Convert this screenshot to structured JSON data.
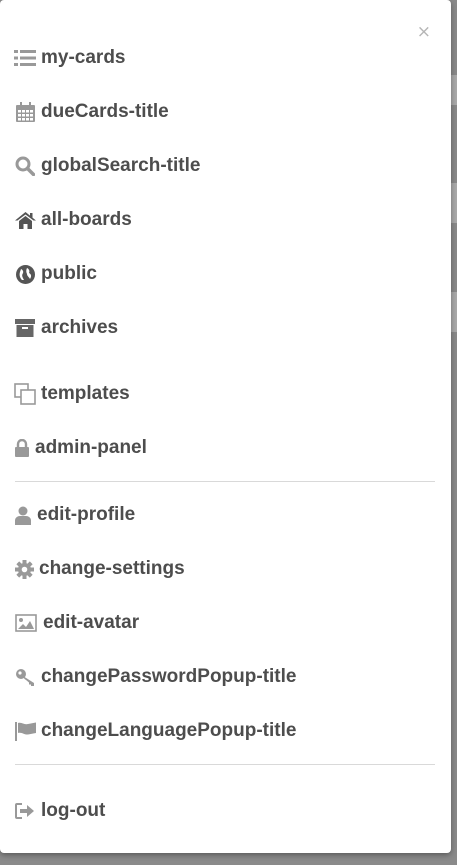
{
  "menu": {
    "close_symbol": "×",
    "items": [
      {
        "label": "my-cards",
        "icon": "list-icon"
      },
      {
        "label": "dueCards-title",
        "icon": "calendar-icon"
      },
      {
        "label": "globalSearch-title",
        "icon": "search-icon"
      },
      {
        "label": "all-boards",
        "icon": "home-icon"
      },
      {
        "label": "public",
        "icon": "globe-icon"
      },
      {
        "label": "archives",
        "icon": "archive-icon"
      },
      {
        "label": "templates",
        "icon": "copy-icon"
      },
      {
        "label": "admin-panel",
        "icon": "lock-icon"
      },
      {
        "label": "edit-profile",
        "icon": "user-icon"
      },
      {
        "label": "change-settings",
        "icon": "gear-icon"
      },
      {
        "label": "edit-avatar",
        "icon": "image-icon"
      },
      {
        "label": "changePasswordPopup-title",
        "icon": "key-icon"
      },
      {
        "label": "changeLanguagePopup-title",
        "icon": "flag-icon"
      },
      {
        "label": "log-out",
        "icon": "sign-out-icon"
      }
    ]
  },
  "colors": {
    "text": "#4d4d4d",
    "icon": "#999999",
    "divider": "#d9d9d9"
  }
}
